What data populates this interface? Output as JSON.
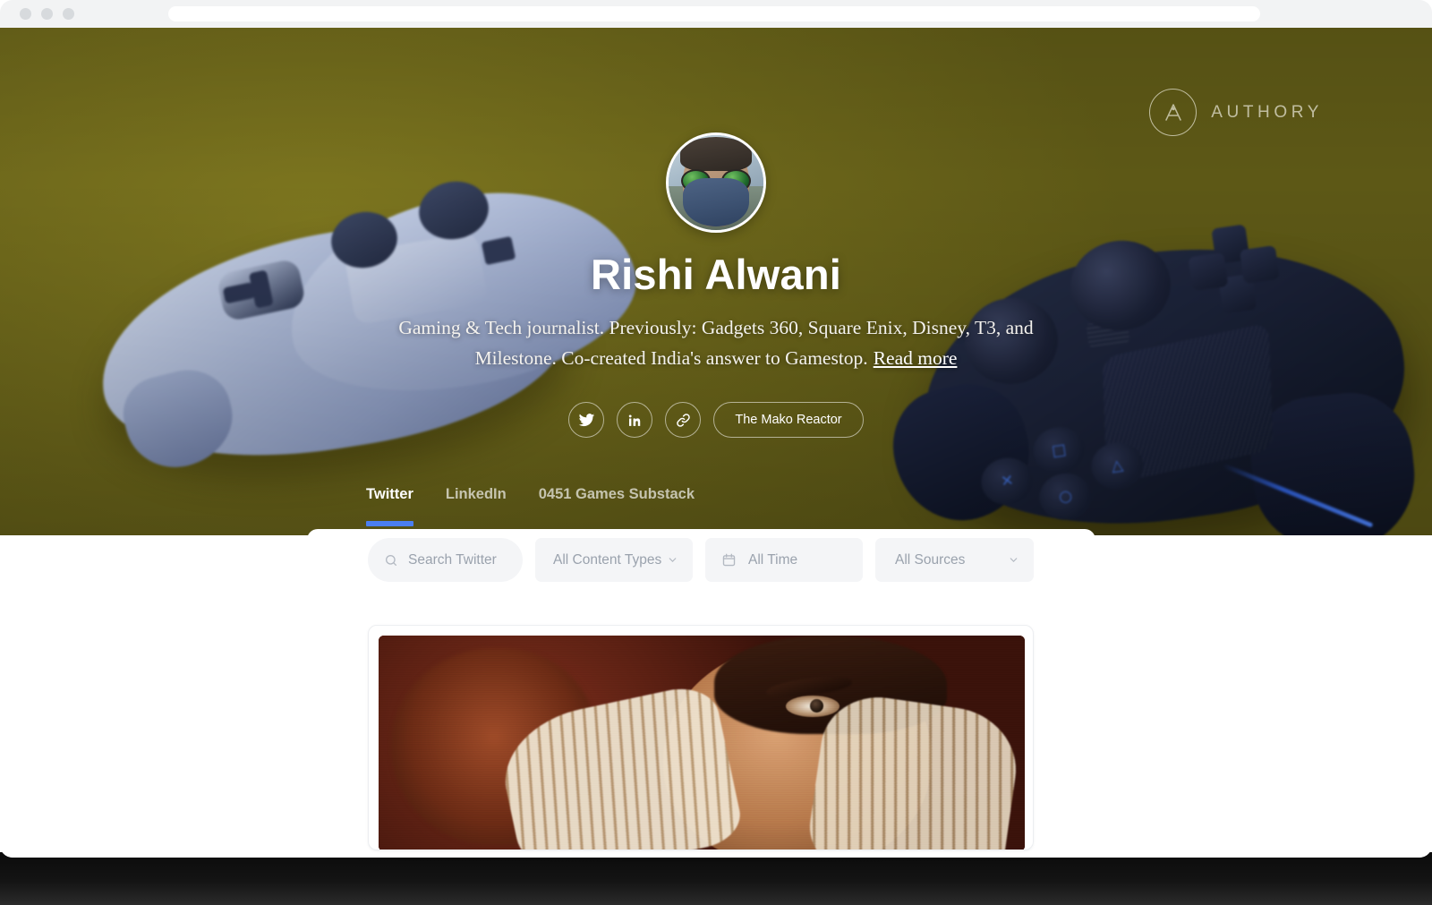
{
  "browser": {
    "traffic_lights": [
      "close",
      "minimize",
      "maximize"
    ],
    "address_bar_value": "",
    "address_bar_placeholder": ""
  },
  "hero": {
    "background_color": "#6b651a",
    "background_description": "two PlayStation DualShock controllers on olive background",
    "brand": {
      "mark": "authory-monogram-a",
      "wordmark": "AUTHORY"
    },
    "avatar": {
      "alt": "person wearing round green mirrored sunglasses and a blue face mask"
    },
    "profile": {
      "name": "Rishi Alwani",
      "bio": "Gaming & Tech journalist. Previously: Gadgets 360, Square Enix, Disney, T3, and Milestone. Co-created India's answer to Gamestop.",
      "read_more_label": "Read more"
    },
    "social": [
      {
        "icon": "twitter-icon",
        "label": "Twitter"
      },
      {
        "icon": "linkedin-icon",
        "label": "LinkedIn"
      },
      {
        "icon": "link-icon",
        "label": "Website link"
      }
    ],
    "cta_button": {
      "label": "The Mako Reactor"
    },
    "tabs": [
      {
        "label": "Twitter",
        "active": true
      },
      {
        "label": "LinkedIn",
        "active": false
      },
      {
        "label": "0451 Games Substack",
        "active": false
      }
    ],
    "active_tab_color": "#4a7ef0"
  },
  "filters": {
    "search": {
      "placeholder": "Search Twitter",
      "value": "",
      "icon": "search-icon"
    },
    "content_type": {
      "label": "All Content Types",
      "icon": "chevron-down-icon"
    },
    "time": {
      "label": "All Time",
      "icon": "calendar-icon",
      "chevron": "chevron-down-icon"
    },
    "sources": {
      "label": "All Sources",
      "icon": "chevron-down-icon"
    }
  },
  "content": {
    "cards": [
      {
        "image_alt": "sepia-toned film still of a man with a striped scarf looking worried"
      }
    ]
  }
}
